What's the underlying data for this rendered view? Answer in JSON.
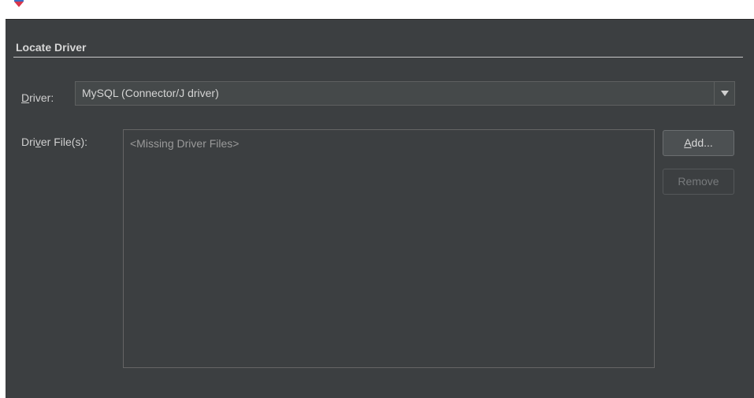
{
  "section": {
    "title": "Locate Driver"
  },
  "driver": {
    "label_mnemonic": "D",
    "label_rest": "river:",
    "selected": "MySQL (Connector/J driver)"
  },
  "driver_files": {
    "label_pre": "Dri",
    "label_mnemonic": "v",
    "label_post": "er File(s):",
    "placeholder": "<Missing Driver Files>"
  },
  "buttons": {
    "add_mnemonic": "A",
    "add_rest": "dd...",
    "remove": "Remove"
  },
  "icons": {
    "app_logo": "app-logo-icon",
    "dropdown_arrow": "chevron-down-icon"
  },
  "colors": {
    "panel_bg": "#3c3f41",
    "text": "#cfcfcf",
    "disabled_text": "#777a7c"
  }
}
